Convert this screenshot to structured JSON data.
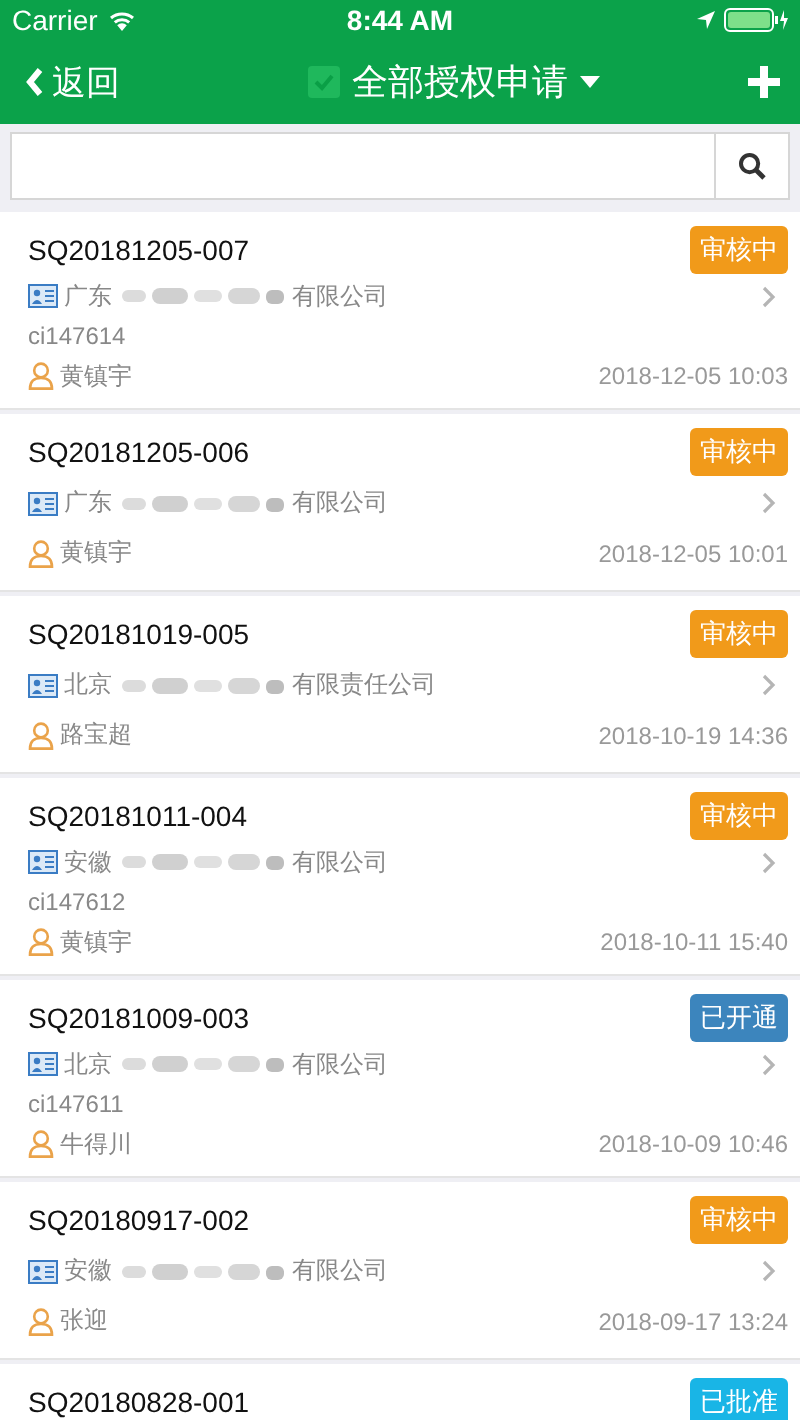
{
  "status_bar": {
    "carrier": "Carrier",
    "time": "8:44 AM"
  },
  "nav": {
    "back": "返回",
    "title": "全部授权申请"
  },
  "applications": [
    {
      "number": "SQ20181205-007",
      "status": "审核中",
      "color": "#f19a1a",
      "company_prefix": "广东",
      "company_suffix": "有限公司",
      "code": "ci147614",
      "person": "黄镇宇",
      "datetime": "2018-12-05 10:03"
    },
    {
      "number": "SQ20181205-006",
      "status": "审核中",
      "color": "#f19a1a",
      "company_prefix": "广东",
      "company_suffix": "有限公司",
      "person": "黄镇宇",
      "datetime": "2018-12-05 10:01"
    },
    {
      "number": "SQ20181019-005",
      "status": "审核中",
      "color": "#f19a1a",
      "company_prefix": "北京",
      "company_suffix": "有限责任公司",
      "person": "路宝超",
      "datetime": "2018-10-19 14:36"
    },
    {
      "number": "SQ20181011-004",
      "status": "审核中",
      "color": "#f19a1a",
      "company_prefix": "安徽",
      "company_suffix": "有限公司",
      "code": "ci147612",
      "person": "黄镇宇",
      "datetime": "2018-10-11 15:40"
    },
    {
      "number": "SQ20181009-003",
      "status": "已开通",
      "color": "#3c85bd",
      "company_prefix": "北京",
      "company_suffix": "有限公司",
      "code": "ci147611",
      "person": "牛得川",
      "datetime": "2018-10-09 10:46"
    },
    {
      "number": "SQ20180917-002",
      "status": "审核中",
      "color": "#f19a1a",
      "company_prefix": "安徽",
      "company_suffix": "有限公司",
      "person": "张迎",
      "datetime": "2018-09-17 13:24"
    },
    {
      "number": "SQ20180828-001",
      "status": "已批准",
      "color": "#19b5e6"
    }
  ]
}
